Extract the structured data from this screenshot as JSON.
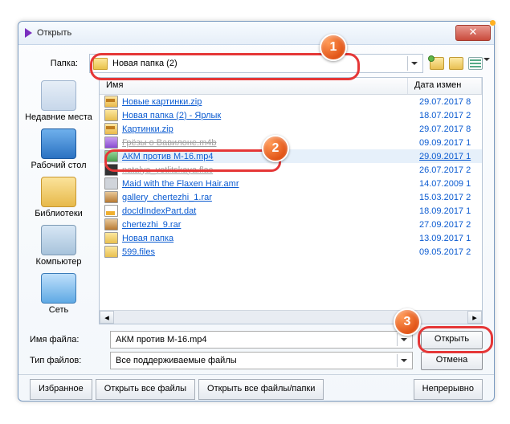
{
  "dialog": {
    "title": "Открыть"
  },
  "folderbar": {
    "label": "Папка:",
    "current": "Новая папка (2)"
  },
  "places": {
    "recent": "Недавние места",
    "desktop": "Рабочий стол",
    "libraries": "Библиотеки",
    "computer": "Компьютер",
    "network": "Сеть"
  },
  "columns": {
    "name": "Имя",
    "date": "Дата измен"
  },
  "files": [
    {
      "icon": "zip",
      "name": "Новые картинки.zip",
      "date": "29.07.2017 8",
      "sel": false
    },
    {
      "icon": "lnk",
      "name": "Новая папка (2) - Ярлык",
      "date": "18.07.2017 2",
      "sel": false
    },
    {
      "icon": "zip",
      "name": "Картинки.zip",
      "date": "29.07.2017 8",
      "sel": false
    },
    {
      "icon": "mp3",
      "name": "Грёзы о Вавилоне.m4b",
      "date": "09.09.2017 1",
      "sel": false,
      "strike": true
    },
    {
      "icon": "mp4",
      "name": "АКМ против М-16.mp4",
      "date": "29.09.2017 1",
      "sel": true
    },
    {
      "icon": "flac",
      "name": "natalya_vetlitskaya.flac",
      "date": "26.07.2017 2",
      "sel": false,
      "strike": true
    },
    {
      "icon": "amr",
      "name": "Maid with the Flaxen Hair.amr",
      "date": "14.07.2009 1",
      "sel": false
    },
    {
      "icon": "rar",
      "name": "gallery_chertezhi_1.rar",
      "date": "15.03.2017 2",
      "sel": false
    },
    {
      "icon": "dat",
      "name": "docIdIndexPart.dat",
      "date": "18.09.2017 1",
      "sel": false
    },
    {
      "icon": "rar",
      "name": "chertezhi_9.rar",
      "date": "27.09.2017 2",
      "sel": false
    },
    {
      "icon": "fold",
      "name": "Новая папка",
      "date": "13.09.2017 1",
      "sel": false
    },
    {
      "icon": "fold",
      "name": "599.files",
      "date": "09.05.2017 2",
      "sel": false
    }
  ],
  "filename": {
    "label": "Имя файла:",
    "value": "АКМ против М-16.mp4"
  },
  "filetype": {
    "label": "Тип файлов:",
    "value": "Все поддерживаемые файлы"
  },
  "actions": {
    "open": "Открыть",
    "cancel": "Отмена"
  },
  "bottom": {
    "favorites": "Избранное",
    "openall": "Открыть все файлы",
    "openallfolders": "Открыть все файлы/папки",
    "continuous": "Непрерывно"
  },
  "badges": {
    "b1": "1",
    "b2": "2",
    "b3": "3"
  }
}
